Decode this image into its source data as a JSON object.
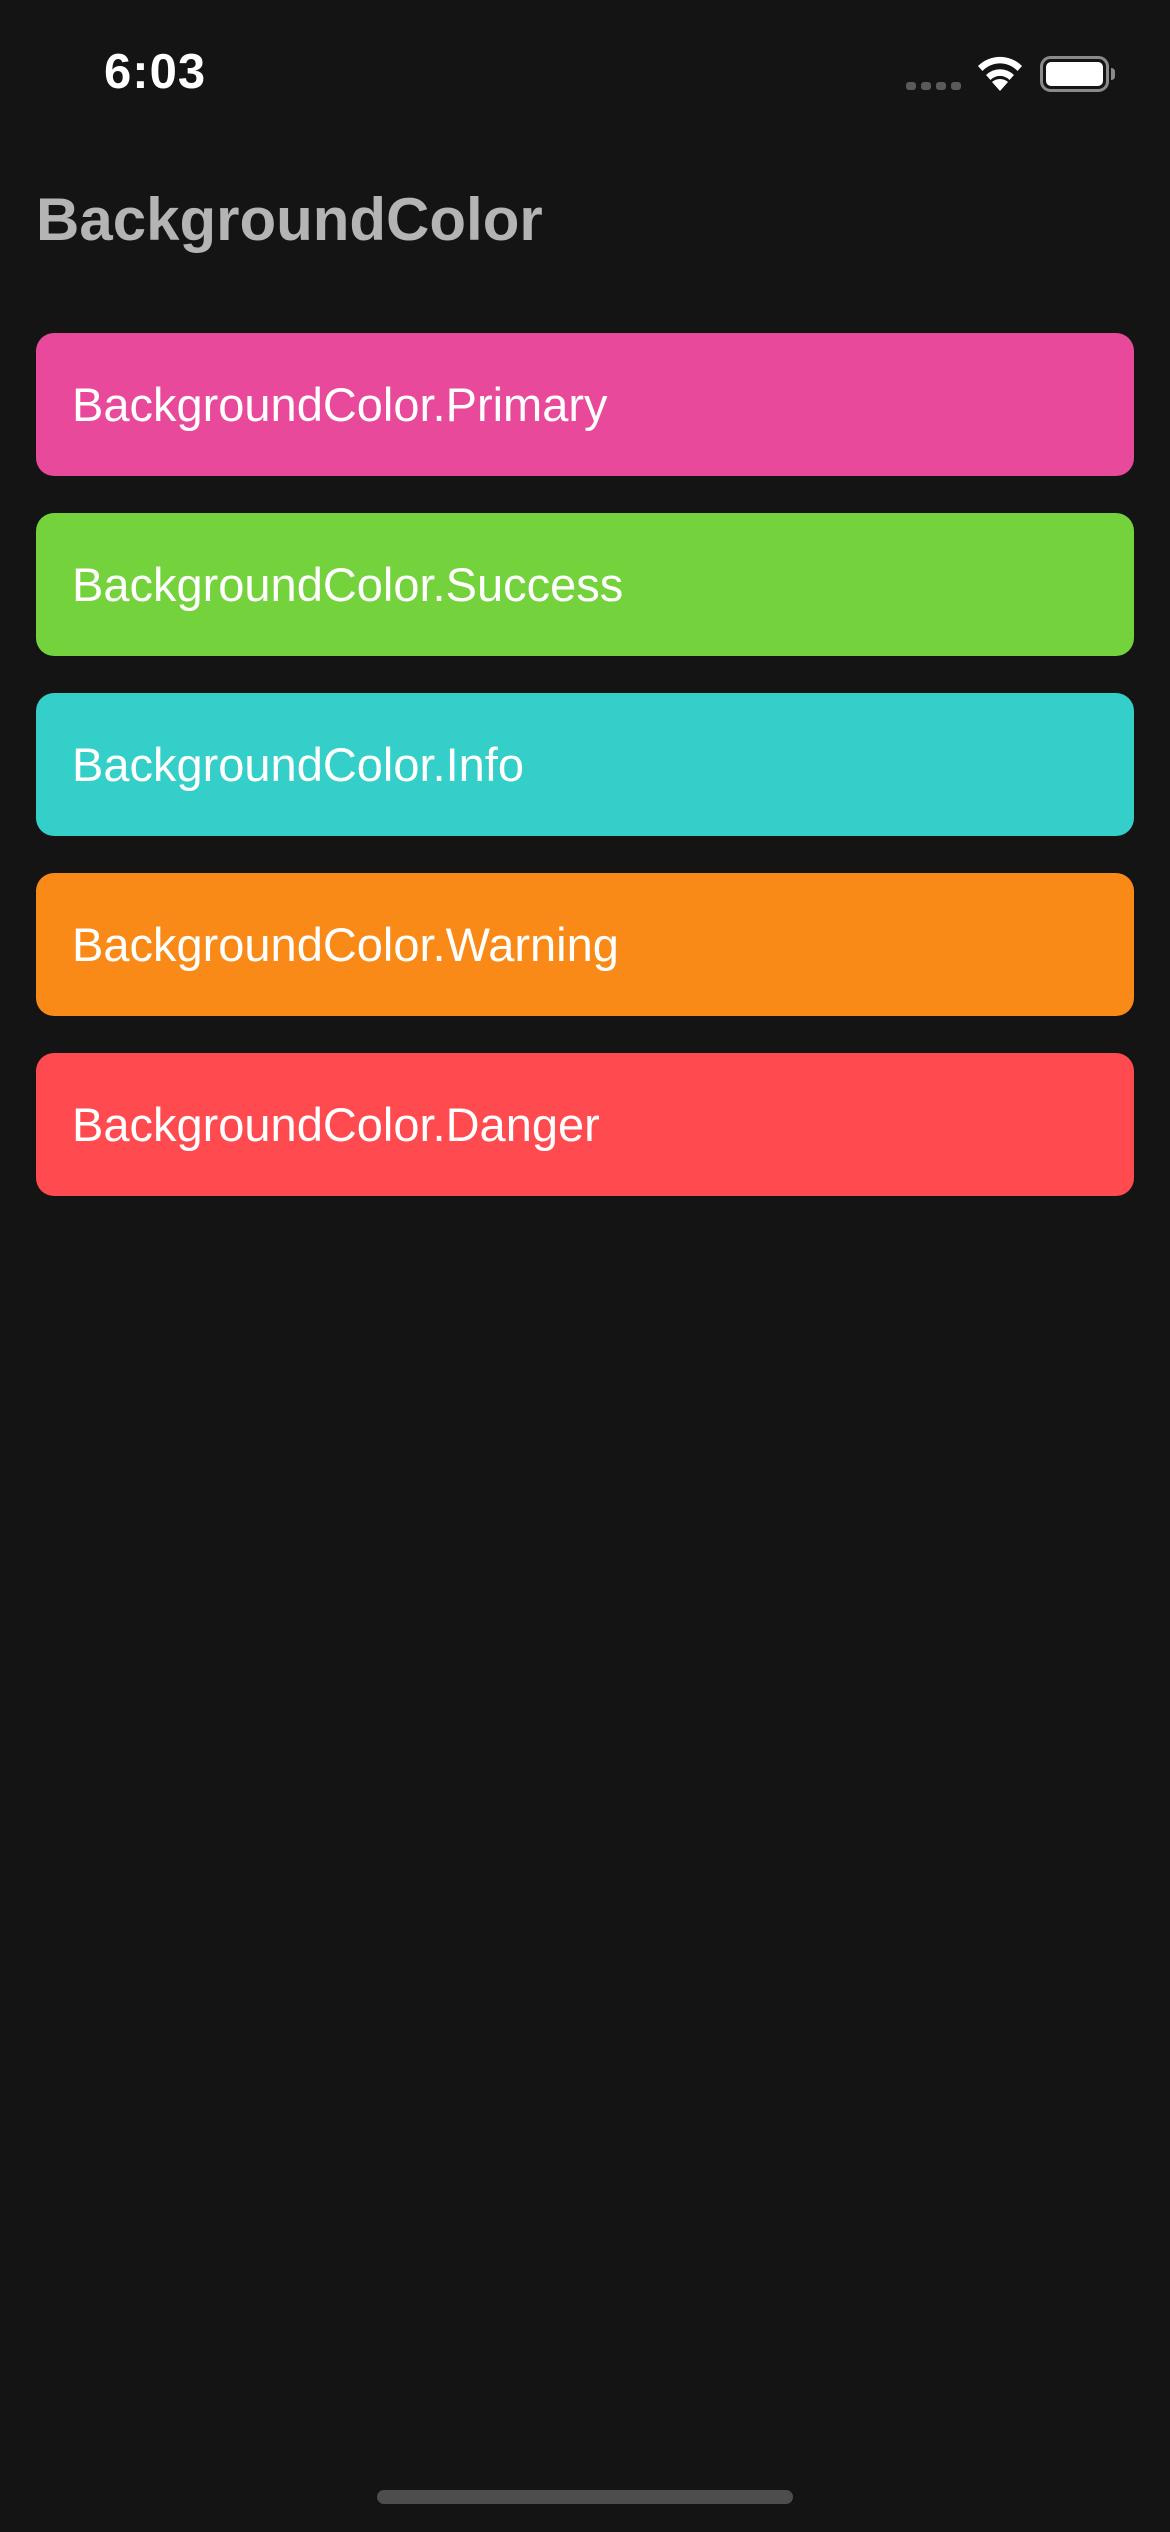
{
  "status_bar": {
    "time": "6:03"
  },
  "page": {
    "title": "BackgroundColor"
  },
  "buttons": [
    {
      "label": "BackgroundColor.Primary",
      "color": "#e9499a"
    },
    {
      "label": "BackgroundColor.Success",
      "color": "#74d33d"
    },
    {
      "label": "BackgroundColor.Info",
      "color": "#35cfca"
    },
    {
      "label": "BackgroundColor.Warning",
      "color": "#fa8a17"
    },
    {
      "label": "BackgroundColor.Danger",
      "color": "#ff4b4f"
    }
  ],
  "icons": {
    "signal": "cellular-signal-icon",
    "wifi": "wifi-icon",
    "battery": "battery-icon"
  }
}
